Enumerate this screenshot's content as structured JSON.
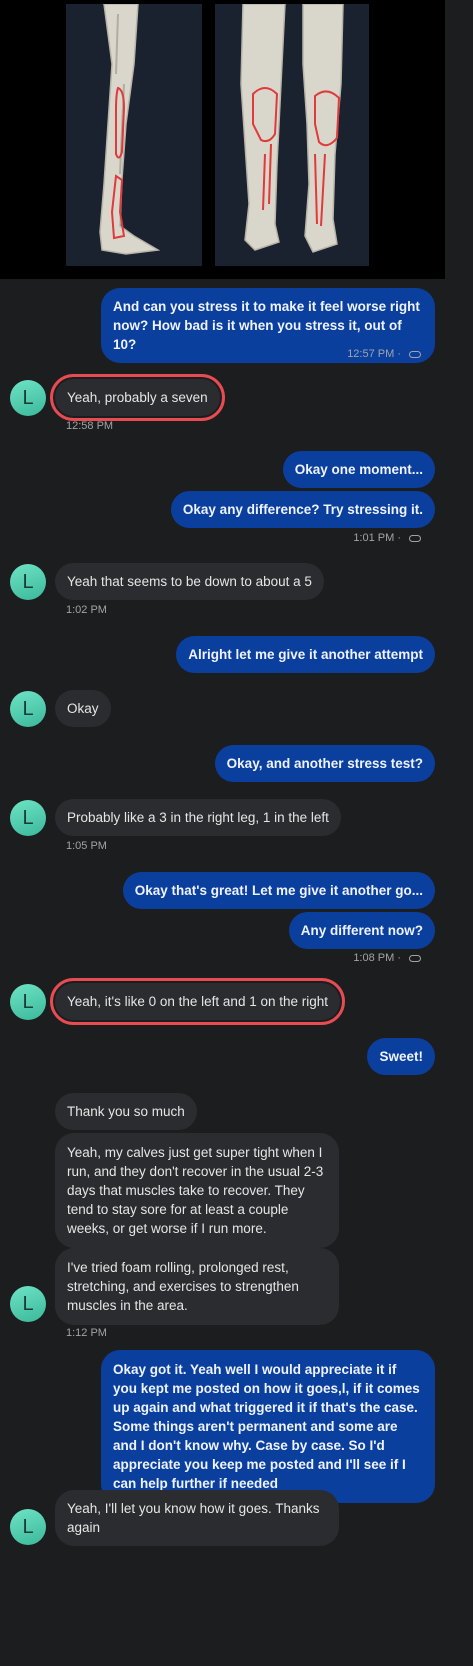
{
  "images": {
    "left_leg_alt": "lateral lower leg anatomy",
    "right_leg_alt": "posterior lower leg anatomy"
  },
  "contact": {
    "avatar_letter": "L",
    "avatar_color": "#4fd1b0"
  },
  "colors": {
    "outgoing": "#0b3f9e",
    "incoming": "#2a2c2f",
    "highlight": "#e84b52",
    "background": "#1c1d1f"
  },
  "messages": [
    {
      "text": "And can you stress it to make it feel worse right now? How bad is it when you stress it, out of 10?",
      "meta": "12:57 PM ·"
    },
    {
      "text": "Yeah, probably a seven",
      "meta": "12:58 PM"
    },
    {
      "text": "Okay one moment..."
    },
    {
      "text": "Okay any difference? Try stressing it.",
      "meta": "1:01 PM ·"
    },
    {
      "text": "Yeah that seems to be down to about a 5",
      "meta": "1:02 PM"
    },
    {
      "text": "Alright let me give it another attempt"
    },
    {
      "text": "Okay"
    },
    {
      "text": "Okay, and another stress test?"
    },
    {
      "text": "Probably like a 3 in the right leg, 1 in the left",
      "meta": "1:05 PM"
    },
    {
      "text": "Okay that's great! Let me give it another go..."
    },
    {
      "text": "Any different now?",
      "meta": "1:08 PM ·"
    },
    {
      "text": "Yeah, it's like 0 on the left and 1 on the right"
    },
    {
      "text": "Sweet!"
    },
    {
      "text": "Thank you so much"
    },
    {
      "text": "Yeah, my calves just get super tight when I run, and they don't recover in the usual 2-3 days that muscles take to recover. They tend to stay sore for at least a couple weeks, or get worse if I run more."
    },
    {
      "text": "I've tried foam rolling, prolonged rest, stretching, and exercises to strengthen muscles in the area.",
      "meta": "1:12 PM"
    },
    {
      "text": "Okay got it. Yeah well I would appreciate it if you kept me posted on how it goes,l, if it comes up again and what triggered it if that's the case. Some things aren't permanent and some are and I don't know why. Case by case. So I'd appreciate you keep me posted and I'll see if I can help further if needed"
    },
    {
      "text": "Yeah, I'll let you know how it goes. Thanks again"
    }
  ]
}
